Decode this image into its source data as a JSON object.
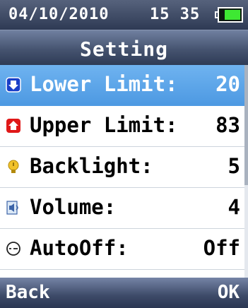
{
  "status": {
    "date": "04/10/2010",
    "time": "15 35",
    "battery_level": 0.7
  },
  "header": {
    "title": "Setting"
  },
  "settings": [
    {
      "label": "Lower Limit:",
      "value": "20",
      "icon": "arrow-down-icon"
    },
    {
      "label": "Upper Limit:",
      "value": "83",
      "icon": "arrow-up-icon"
    },
    {
      "label": "Backlight:",
      "value": "5",
      "icon": "bulb-icon"
    },
    {
      "label": "Volume:",
      "value": "4",
      "icon": "speaker-icon"
    },
    {
      "label": "AutoOff:",
      "value": "Off",
      "icon": "clock-icon"
    }
  ],
  "softkeys": {
    "left": "Back",
    "right": "OK"
  },
  "colors": {
    "selected_row": "#4d99e2",
    "bar": "#3d4a68",
    "battery": "#3ee833"
  }
}
